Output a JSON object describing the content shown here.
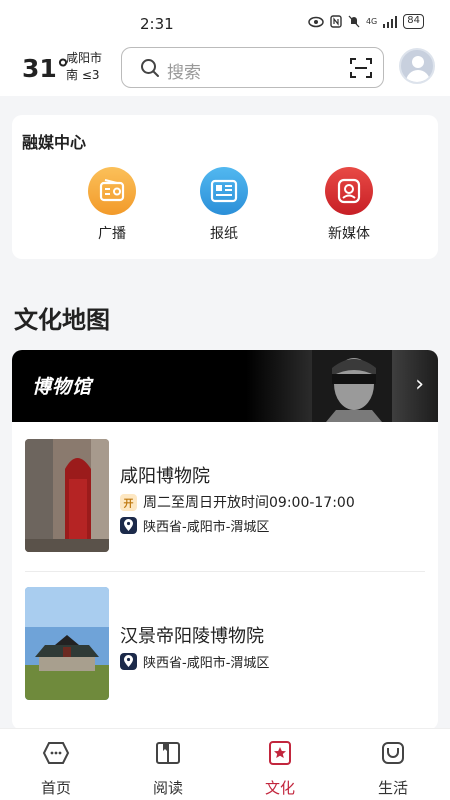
{
  "status_bar": {
    "time": "2:31",
    "network": "4G",
    "battery": "84"
  },
  "header": {
    "temperature": "31°",
    "city": "咸阳市",
    "wind": "南 ≤3",
    "search_placeholder": "搜索"
  },
  "rongmei": {
    "title": "融媒中心",
    "items": [
      {
        "label": "广播",
        "icon": "radio-icon",
        "color": "#f7a83a"
      },
      {
        "label": "报纸",
        "icon": "newspaper-icon",
        "color": "#3aa6e6"
      },
      {
        "label": "新媒体",
        "icon": "new-media-icon",
        "color": "#d8312f"
      }
    ]
  },
  "culture_map": {
    "title": "文化地图",
    "banner_title": "博物馆",
    "museums": [
      {
        "name": "咸阳博物院",
        "open_tag": "开",
        "hours": "周二至周日开放时间09:00-17:00",
        "location": "陕西省-咸阳市-渭城区"
      },
      {
        "name": "汉景帝阳陵博物院",
        "location": "陕西省-咸阳市-渭城区"
      }
    ]
  },
  "tabbar": {
    "items": [
      {
        "label": "首页",
        "icon": "home-icon"
      },
      {
        "label": "阅读",
        "icon": "book-icon"
      },
      {
        "label": "文化",
        "icon": "culture-icon",
        "active": true
      },
      {
        "label": "生活",
        "icon": "life-icon"
      }
    ],
    "active_color": "#c2263d"
  }
}
